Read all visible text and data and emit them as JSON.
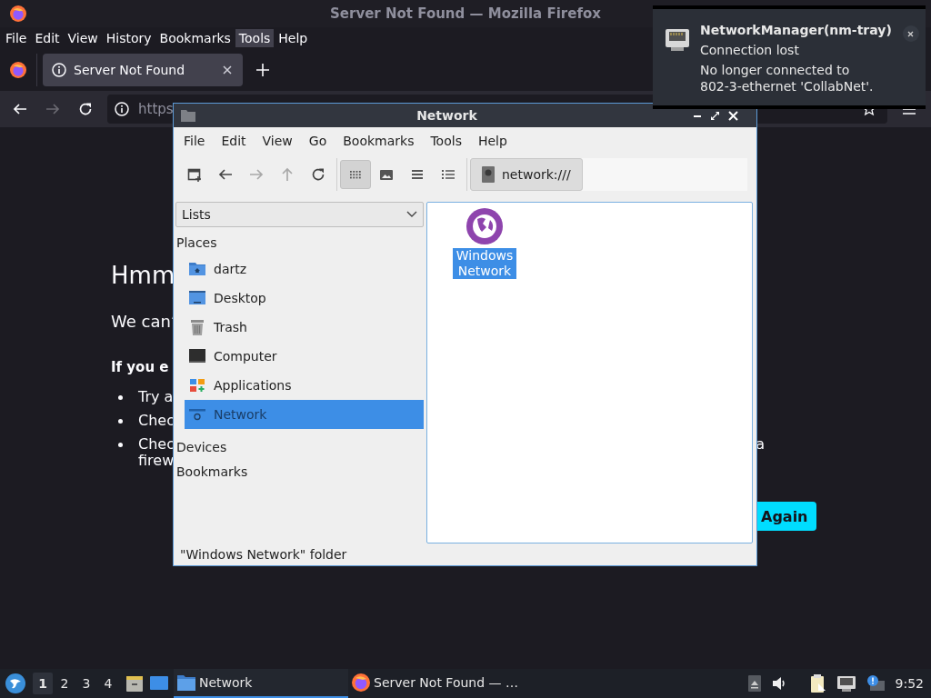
{
  "browser": {
    "title": "Server Not Found — Mozilla Firefox",
    "menu": [
      {
        "label": "File",
        "selected": false
      },
      {
        "label": "Edit",
        "selected": false
      },
      {
        "label": "View",
        "selected": false
      },
      {
        "label": "History",
        "selected": false
      },
      {
        "label": "Bookmarks",
        "selected": false
      },
      {
        "label": "Tools",
        "selected": true
      },
      {
        "label": "Help",
        "selected": false
      }
    ],
    "tabs": [
      {
        "label": "Server Not Found",
        "selected": true
      }
    ],
    "navigation": [
      {
        "kind": "back",
        "disabled": false
      },
      {
        "kind": "forward",
        "disabled": true
      },
      {
        "kind": "reload",
        "disabled": false
      }
    ],
    "address": "https",
    "page": {
      "heading": "Hmm",
      "message": "We can’",
      "subheading": "If you e",
      "bullets": [
        {
          "lines": [
            "Try a"
          ]
        },
        {
          "lines": [
            "Chec"
          ]
        },
        {
          "lines": [
            "Chec",
            "firew"
          ],
          "tail": "a"
        }
      ],
      "button": "Again"
    }
  },
  "file_manager": {
    "title": "Network",
    "menu": [
      "File",
      "Edit",
      "View",
      "Go",
      "Bookmarks",
      "Tools",
      "Help"
    ],
    "actions": [
      {
        "kind": "new-tab",
        "disabled": false
      },
      {
        "kind": "back",
        "disabled": false
      },
      {
        "kind": "forward",
        "disabled": true
      },
      {
        "kind": "up",
        "disabled": true
      },
      {
        "kind": "reload",
        "disabled": false
      }
    ],
    "views": [
      {
        "kind": "icon",
        "selected": true
      },
      {
        "kind": "thumbnail",
        "selected": false
      },
      {
        "kind": "compact",
        "selected": false
      },
      {
        "kind": "detailed",
        "selected": false
      }
    ],
    "location": "network:///",
    "side_pane": {
      "selector": "Lists",
      "sections": [
        {
          "label": "Places",
          "items": [
            {
              "label": "dartz",
              "kind": "home",
              "selected": false
            },
            {
              "label": "Desktop",
              "kind": "desktop",
              "selected": false
            },
            {
              "label": "Trash",
              "kind": "trash",
              "selected": false
            },
            {
              "label": "Computer",
              "kind": "computer",
              "selected": false
            },
            {
              "label": "Applications",
              "kind": "applications",
              "selected": false
            },
            {
              "label": "Network",
              "kind": "network",
              "selected": true
            }
          ]
        },
        {
          "label": "Devices"
        },
        {
          "label": "Bookmarks"
        }
      ]
    },
    "files": [
      {
        "label": "Windows Network",
        "selected": true
      }
    ],
    "status": "\"Windows Network\" folder"
  },
  "notification": {
    "app": "NetworkManager(nm-tray)",
    "summary": "Connection lost",
    "body": [
      "No longer connected to",
      "802-3-ethernet 'CollabNet'."
    ]
  },
  "taskbar": {
    "desktops": [
      {
        "label": "1",
        "selected": true
      },
      {
        "label": "2",
        "selected": false
      },
      {
        "label": "3",
        "selected": false
      },
      {
        "label": "4",
        "selected": false
      }
    ],
    "tasks": [
      {
        "label": "Network",
        "kind": "file-manager",
        "selected": true
      },
      {
        "label": "Server Not Found — …",
        "kind": "browser",
        "selected": false
      }
    ],
    "clock": "9:52"
  }
}
